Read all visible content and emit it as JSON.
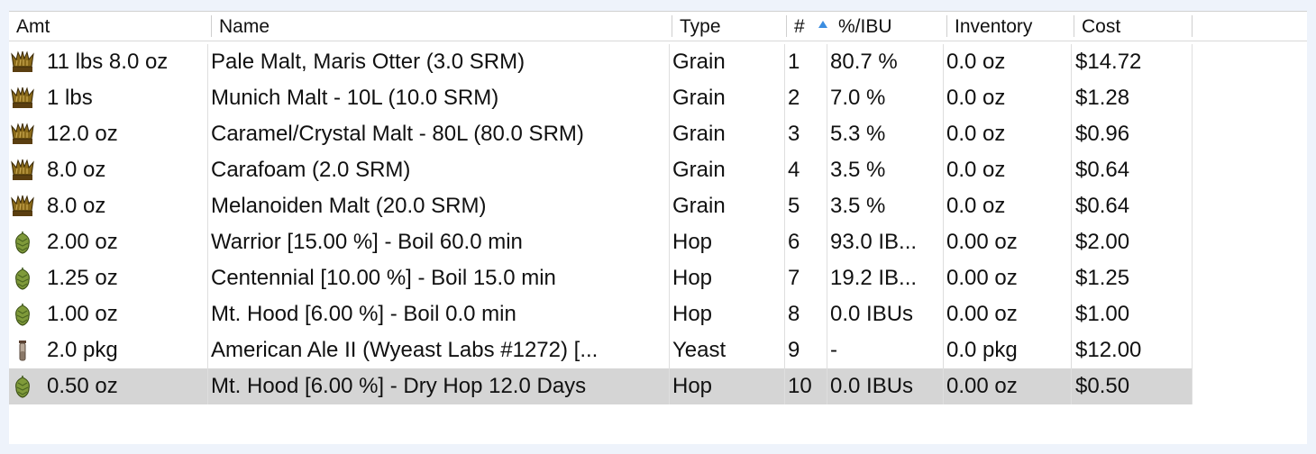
{
  "table": {
    "columns": [
      "Amt",
      "Name",
      "Type",
      "#",
      "%/IBU",
      "Inventory",
      "Cost"
    ],
    "sorted_column": "#",
    "rows": [
      {
        "icon": "grain-icon",
        "amt": "11 lbs 8.0 oz",
        "name": "Pale Malt, Maris Otter (3.0 SRM)",
        "type": "Grain",
        "num": "1",
        "pct": "80.7 %",
        "inventory": "0.0 oz",
        "cost": "$14.72"
      },
      {
        "icon": "grain-icon",
        "amt": "1 lbs",
        "name": "Munich Malt - 10L (10.0 SRM)",
        "type": "Grain",
        "num": "2",
        "pct": "7.0 %",
        "inventory": "0.0 oz",
        "cost": "$1.28"
      },
      {
        "icon": "grain-icon",
        "amt": "12.0 oz",
        "name": "Caramel/Crystal Malt - 80L (80.0 SRM)",
        "type": "Grain",
        "num": "3",
        "pct": "5.3 %",
        "inventory": "0.0 oz",
        "cost": "$0.96"
      },
      {
        "icon": "grain-icon",
        "amt": "8.0 oz",
        "name": "Carafoam (2.0 SRM)",
        "type": "Grain",
        "num": "4",
        "pct": "3.5 %",
        "inventory": "0.0 oz",
        "cost": "$0.64"
      },
      {
        "icon": "grain-icon",
        "amt": "8.0 oz",
        "name": "Melanoiden Malt (20.0 SRM)",
        "type": "Grain",
        "num": "5",
        "pct": "3.5 %",
        "inventory": "0.0 oz",
        "cost": "$0.64"
      },
      {
        "icon": "hop-icon",
        "amt": "2.00 oz",
        "name": "Warrior [15.00 %] - Boil 60.0 min",
        "type": "Hop",
        "num": "6",
        "pct": "93.0 IB...",
        "inventory": "0.00 oz",
        "cost": "$2.00"
      },
      {
        "icon": "hop-icon",
        "amt": "1.25 oz",
        "name": "Centennial [10.00 %] - Boil 15.0 min",
        "type": "Hop",
        "num": "7",
        "pct": "19.2 IB...",
        "inventory": "0.00 oz",
        "cost": "$1.25"
      },
      {
        "icon": "hop-icon",
        "amt": "1.00 oz",
        "name": "Mt. Hood [6.00 %] - Boil 0.0 min",
        "type": "Hop",
        "num": "8",
        "pct": "0.0 IBUs",
        "inventory": "0.00 oz",
        "cost": "$1.00"
      },
      {
        "icon": "yeast-vial-icon",
        "amt": "2.0 pkg",
        "name": "American Ale II (Wyeast Labs #1272) [...",
        "type": "Yeast",
        "num": "9",
        "pct": "-",
        "inventory": "0.0 pkg",
        "cost": "$12.00"
      },
      {
        "icon": "hop-icon",
        "amt": "0.50 oz",
        "name": "Mt. Hood [6.00 %] - Dry Hop 12.0 Days",
        "type": "Hop",
        "num": "10",
        "pct": "0.0 IBUs",
        "inventory": "0.00 oz",
        "cost": "$0.50",
        "selected": true
      }
    ]
  }
}
